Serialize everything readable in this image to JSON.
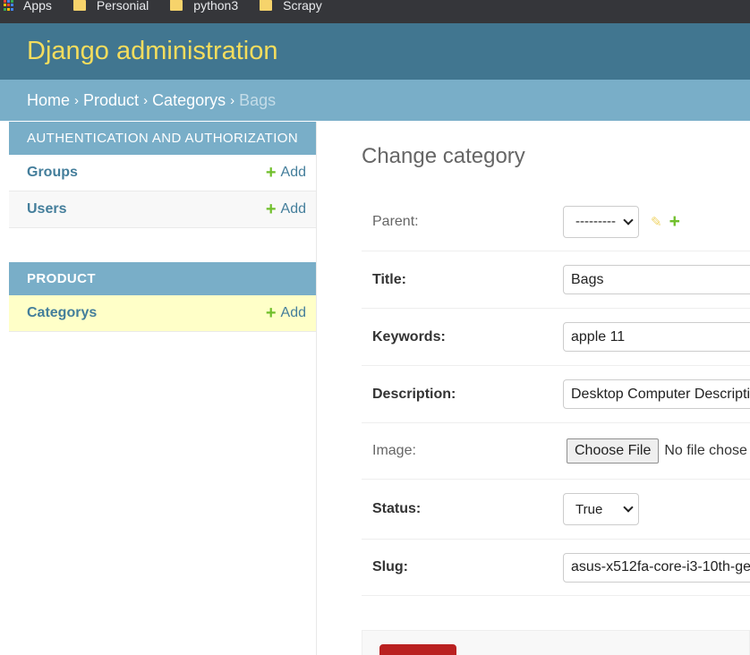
{
  "bookmarks": [
    {
      "label": "Apps",
      "icon": "apps-grid-icon"
    },
    {
      "label": "Personial",
      "icon": "folder-icon"
    },
    {
      "label": "python3",
      "icon": "folder-icon"
    },
    {
      "label": "Scrapy",
      "icon": "folder-icon"
    }
  ],
  "header": {
    "brand": "Django administration"
  },
  "breadcrumbs": {
    "home": "Home",
    "app": "Product",
    "model": "Categorys",
    "current": "Bags",
    "separator": "›"
  },
  "sidebar": {
    "modules": [
      {
        "caption": "AUTHENTICATION AND AUTHORIZATION",
        "models": [
          {
            "name": "Groups",
            "add": "Add"
          },
          {
            "name": "Users",
            "add": "Add"
          }
        ]
      },
      {
        "caption": "PRODUCT",
        "models": [
          {
            "name": "Categorys",
            "add": "Add"
          }
        ]
      }
    ]
  },
  "content": {
    "title": "Change category",
    "fields": {
      "parent": {
        "label": "Parent:",
        "value": "---------"
      },
      "title": {
        "label": "Title:",
        "value": "Bags"
      },
      "keywords": {
        "label": "Keywords:",
        "value": "apple 11"
      },
      "description": {
        "label": "Description:",
        "value": "Desktop Computer Descripti"
      },
      "image": {
        "label": "Image:",
        "button": "Choose File",
        "status": "No file chose"
      },
      "status": {
        "label": "Status:",
        "value": "True"
      },
      "slug": {
        "label": "Slug:",
        "value": "asus-x512fa-core-i3-10th-ge"
      }
    }
  },
  "colors": {
    "header": "#417690",
    "breadcrumbs": "#79aec8",
    "brand": "#f5dd5d",
    "link": "#447e9b",
    "add_green": "#70bf2b",
    "current_row": "#ffffc8",
    "delete": "#ba2121"
  }
}
